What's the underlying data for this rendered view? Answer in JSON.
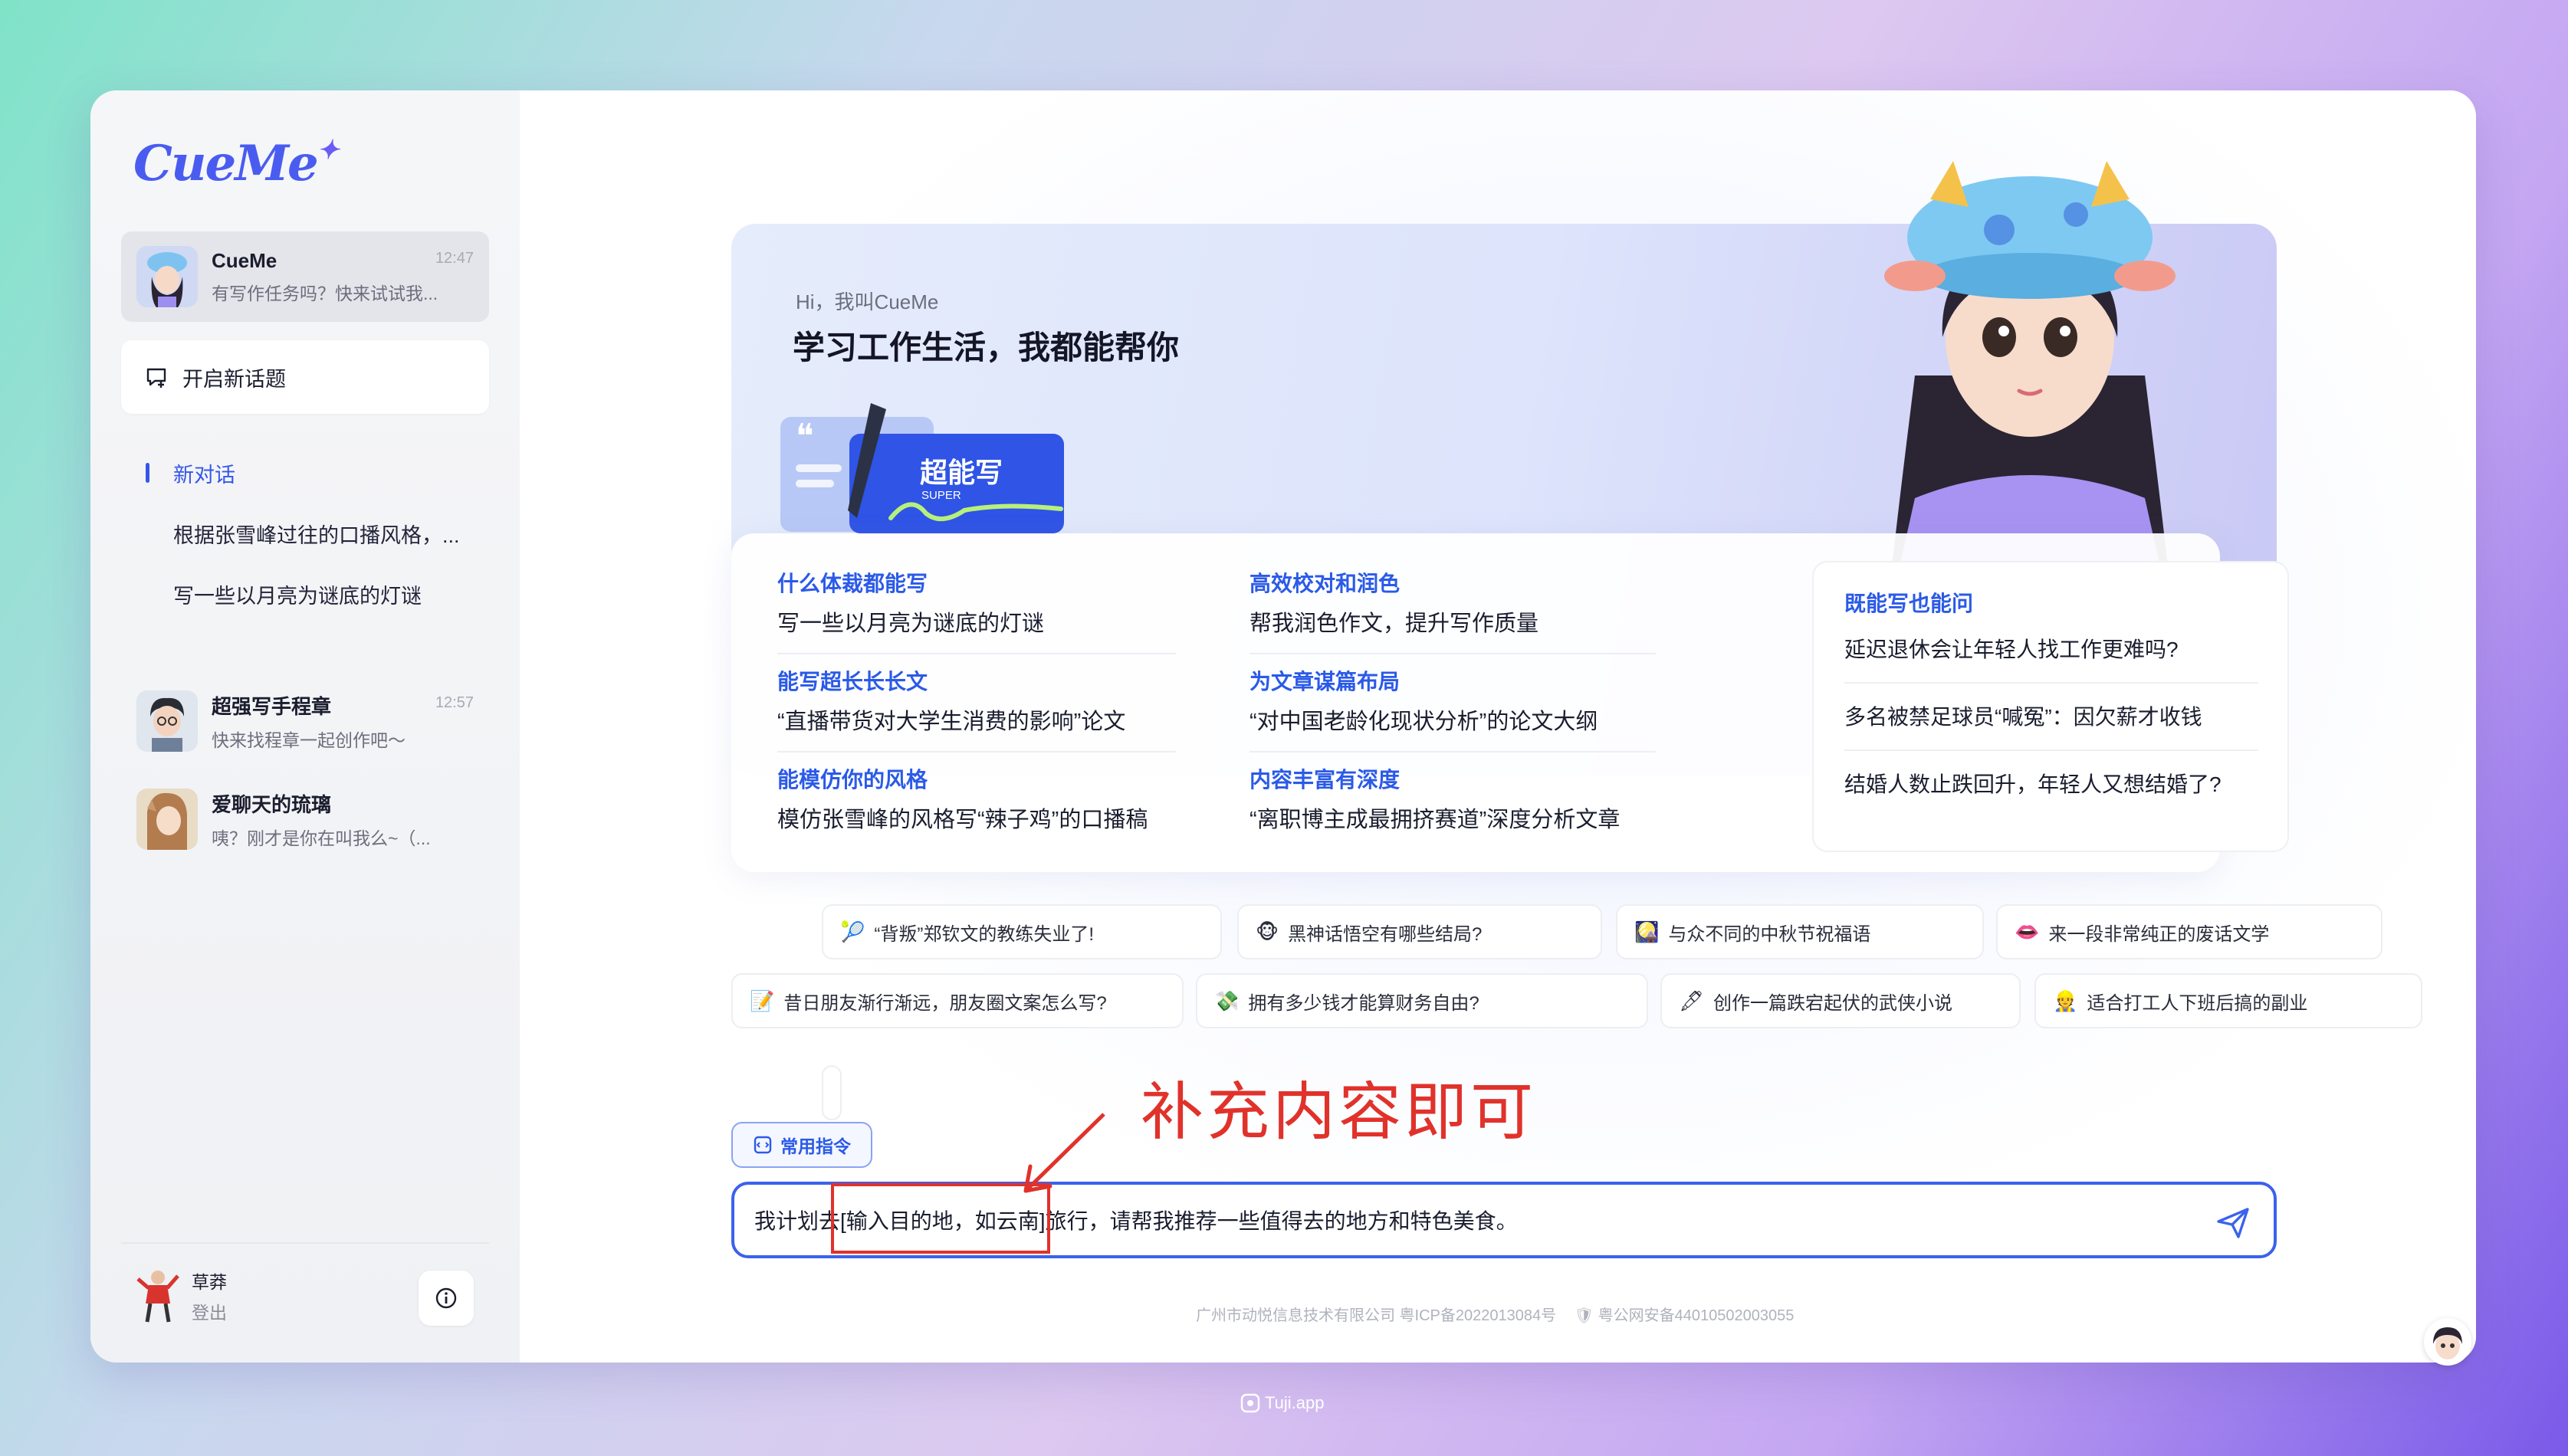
{
  "app": {
    "logo_text": "CueMe",
    "logo_star": "✦"
  },
  "sidebar": {
    "active_chat": {
      "name": "CueMe",
      "preview": "有写作任务吗？快来试试我...",
      "time": "12:47"
    },
    "new_topic_label": "开启新话题",
    "history": [
      "新对话",
      "根据张雪峰过往的口播风格，...",
      "写一些以月亮为谜底的灯谜"
    ],
    "chats": [
      {
        "name": "超强写手程章",
        "preview": "快来找程章一起创作吧～",
        "time": "12:57"
      },
      {
        "name": "爱聊天的琉璃",
        "preview": "咦？刚才是你在叫我么~（...",
        "time": ""
      }
    ],
    "user": {
      "name": "草莽",
      "logout_label": "登出"
    },
    "info_icon": "info-icon"
  },
  "hero": {
    "greeting": "Hi，我叫CueMe",
    "title": "学习工作生活，我都能帮你",
    "card_title": "超能写",
    "card_sub": "SUPER"
  },
  "features": [
    {
      "title": "什么体裁都能写",
      "desc": "写一些以月亮为谜底的灯谜"
    },
    {
      "title": "能写超长长长文",
      "desc": "“直播带货对大学生消费的影响”论文"
    },
    {
      "title": "能模仿你的风格",
      "desc": "模仿张雪峰的风格写“辣子鸡”的口播稿"
    },
    {
      "title": "高效校对和润色",
      "desc": "帮我润色作文，提升写作质量"
    },
    {
      "title": "为文章谋篇布局",
      "desc": "“对中国老龄化现状分析”的论文大纲"
    },
    {
      "title": "内容丰富有深度",
      "desc": "“离职博主成最拥挤赛道”深度分析文章"
    }
  ],
  "ask": {
    "title": "既能写也能问",
    "questions": [
      "延迟退休会让年轻人找工作更难吗?",
      "多名被禁足球员“喊冤”：因欠薪才收钱",
      "结婚人数止跌回升，年轻人又想结婚了?"
    ]
  },
  "chips_row1": [
    {
      "emoji": "🎾",
      "text": "“背叛”郑钦文的教练失业了!"
    },
    {
      "emoji": "🐵",
      "text": "黑神话悟空有哪些结局?"
    },
    {
      "emoji": "🎑",
      "text": "与众不同的中秋节祝福语"
    },
    {
      "emoji": "👄",
      "text": "来一段非常纯正的废话文学"
    }
  ],
  "chips_row2": [
    {
      "emoji": "📝",
      "text": "昔日朋友渐行渐远，朋友圈文案怎么写?"
    },
    {
      "emoji": "💸",
      "text": "拥有多少钱才能算财务自由?"
    },
    {
      "emoji": "🖋",
      "text": "创作一篇跌宕起伏的武侠小说"
    },
    {
      "emoji": "👷",
      "text": "适合打工人下班后搞的副业"
    }
  ],
  "command_label": "常用指令",
  "input": {
    "prefix": "我计划去",
    "placeholder": "[输入目的地，如云南]",
    "suffix": "旅行，请帮我推荐一些值得去的地方和特色美食。"
  },
  "annotation": "补充内容即可",
  "footer": {
    "company": "广州市动悦信息技术有限公司 粤ICP备2022013084号",
    "police": "粤公网安备44010502003055"
  },
  "watermark": "Tuji.app",
  "colors": {
    "accent": "#3a62ec",
    "annotation": "#e0322b"
  }
}
